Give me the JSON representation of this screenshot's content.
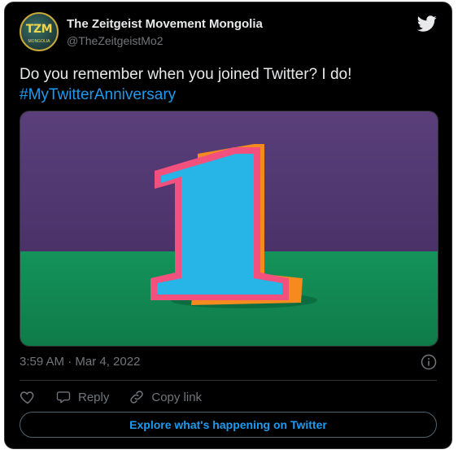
{
  "tweet": {
    "author": {
      "display_name": "The Zeitgeist Movement Mongolia",
      "handle": "@TheZeitgeistMo2",
      "avatar_text": "TZM",
      "avatar_subtext": "MONGOLIA"
    },
    "text": "Do you remember when you joined Twitter? I do!",
    "hashtag": "#MyTwitterAnniversary",
    "timestamp": "3:59 AM · Mar 4, 2022",
    "media_icon": "number-one-papercraft-image"
  },
  "actions": {
    "like_icon": "heart-icon",
    "reply_label": "Reply",
    "reply_icon": "reply-icon",
    "copy_link_label": "Copy link",
    "copy_link_icon": "link-icon"
  },
  "explore_button": {
    "label": "Explore what's happening on Twitter"
  },
  "colors": {
    "background": "#000000",
    "text": "#e7e9ea",
    "muted": "#71767b",
    "accent": "#1d9bf0",
    "border": "#2f3336"
  }
}
